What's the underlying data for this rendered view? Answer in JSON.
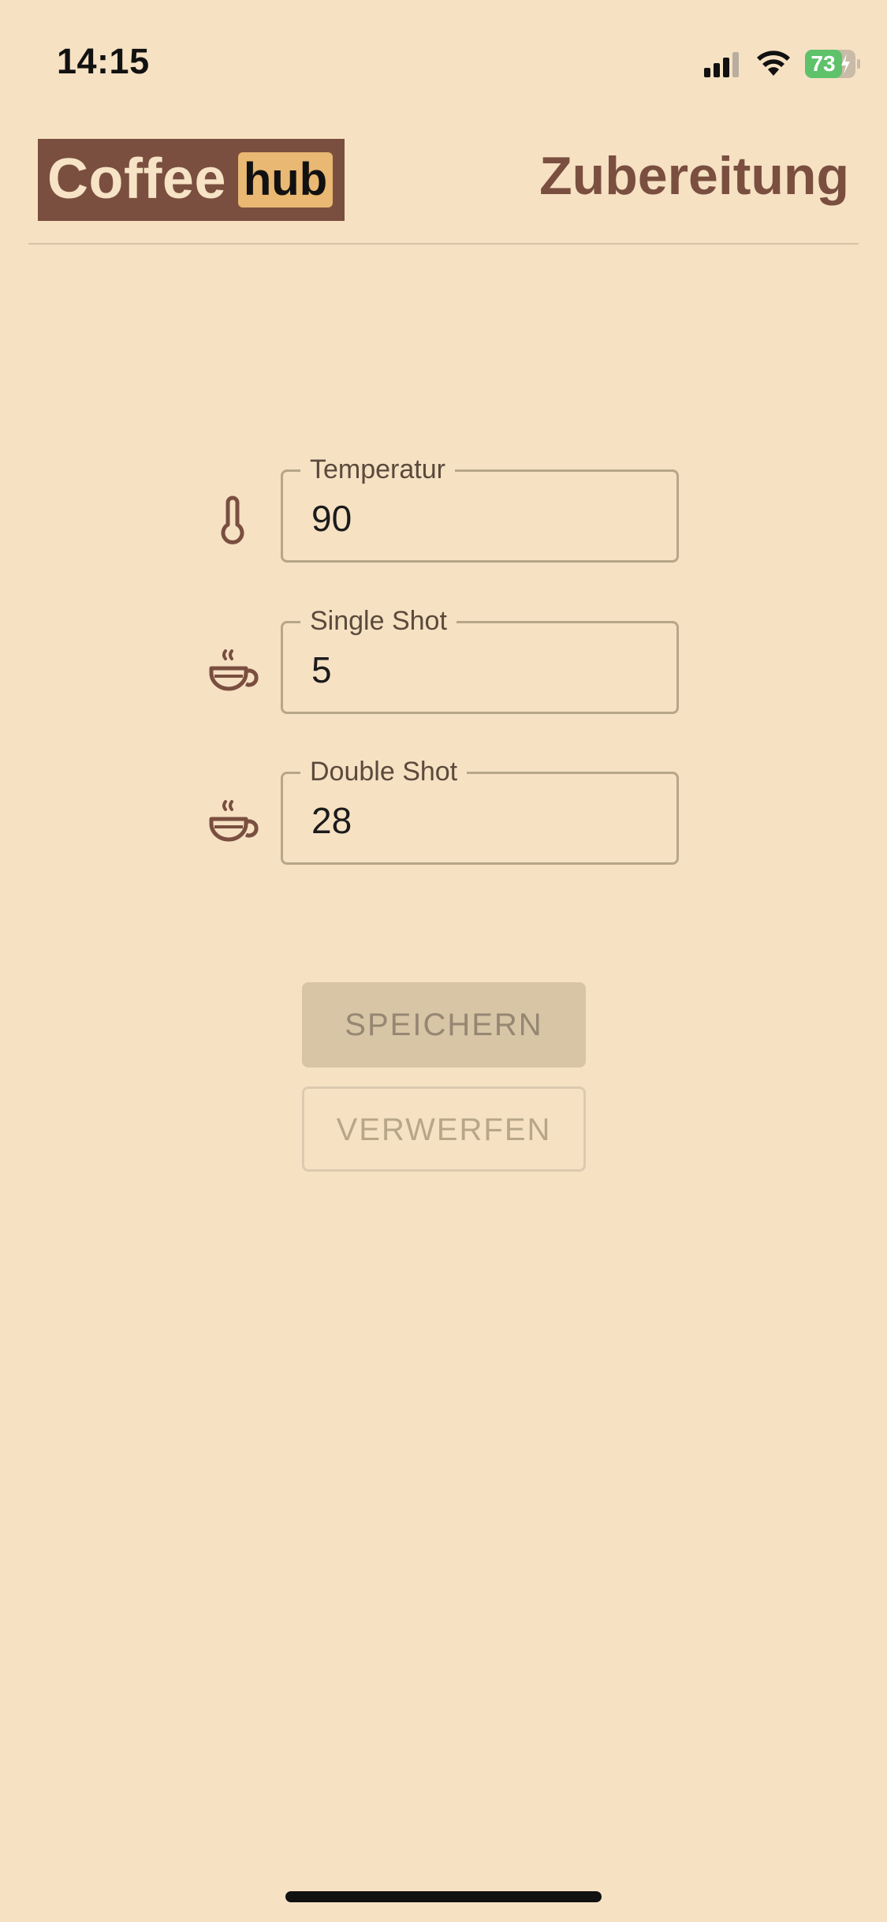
{
  "status_bar": {
    "time": "14:15",
    "battery_level": "73",
    "battery_color": "#5ec26a",
    "icons": [
      "signal-icon",
      "wifi-icon",
      "battery-icon"
    ]
  },
  "header": {
    "logo_coffee": "Coffee",
    "logo_hub": "hub",
    "title": "Zubereitung"
  },
  "form": {
    "fields": [
      {
        "label": "Temperatur",
        "value": "90",
        "icon": "thermometer-icon"
      },
      {
        "label": "Single Shot",
        "value": "5",
        "icon": "coffee-cup-icon"
      },
      {
        "label": "Double Shot",
        "value": "28",
        "icon": "coffee-cup-icon"
      }
    ]
  },
  "actions": {
    "save_label": "SPEICHERN",
    "discard_label": "VERWERFEN"
  },
  "colors": {
    "background": "#f6e1c3",
    "brand_brown": "#7a4f3f",
    "logo_accent": "#e9b872"
  }
}
